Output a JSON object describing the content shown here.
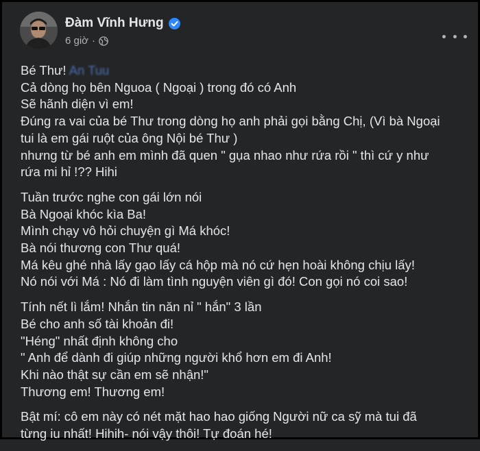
{
  "post": {
    "author": "Đàm Vĩnh Hưng",
    "timestamp": "6 giờ",
    "separator": "·",
    "audience_icon": "globe-icon",
    "verified_icon": "verified-badge-icon",
    "more_icon": "more-options-icon",
    "first_line_prefix": "Bé Thư!",
    "mention": "An Tuu",
    "paragraphs": [
      [
        "Cả dòng họ bên Nguoa ( Ngoại ) trong đó có Anh",
        "Sẽ hãnh diện vì em!",
        "Đúng ra vai của bé Thư trong dòng họ anh phải gọi bằng Chị, (Vì bà Ngoại",
        "tui là em gái ruột của ông Nội bé Thư )",
        "nhưng từ bé anh em mình đã quen \" gụa nhao như rứa rồi \" thì cứ y như",
        "rứa mi hỉ !?? Hihi"
      ],
      [
        "Tuần trước nghe con gái lớn nói",
        "Bà Ngoại khóc kìa Ba!",
        "Mình chạy vô hỏi chuyện gì Má khóc!",
        "Bà nói thương con Thư quá!",
        "Má kêu ghé nhà lấy gạo lấy cá hộp mà nó cứ hẹn hoài không chịu lấy!",
        "Nó nói với Má : Nó đi làm tình nguyện viên gì đó! Con gọi nó coi sao!"
      ],
      [
        "Tính nết lì lắm! Nhắn tin năn nỉ \" hắn\" 3 lần",
        "Bé cho anh số tài khoản đi!",
        "\"Héng\" nhất định không cho",
        "\" Anh để dành đi giúp những người khổ hơn em đi Anh!",
        "Khi nào thật sự cần em sẽ nhận!\"",
        "Thương em! Thương em!"
      ],
      [
        "Bật mí: cô em này có nét mặt hao hao giống  Người nữ ca sỹ mà tui đã",
        "từng iu nhất! Hihih- nói vậy thôi! Tự đoán hé!"
      ]
    ]
  },
  "colors": {
    "background": "#242526",
    "text": "#e4e6eb",
    "secondary_text": "#b0b3b8",
    "verified": "#2d88ff",
    "mention": "#4a6fb3"
  }
}
